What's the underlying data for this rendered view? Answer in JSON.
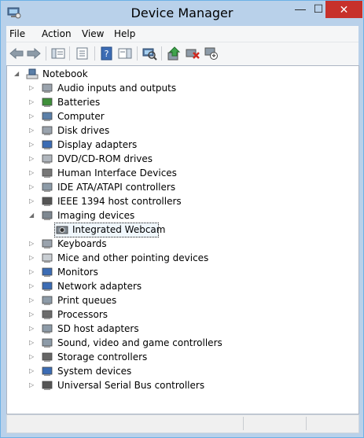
{
  "window": {
    "title": "Device Manager",
    "minimize": "—",
    "maximize": "☐",
    "close": "✕"
  },
  "menu": [
    "File",
    "Action",
    "View",
    "Help"
  ],
  "toolbar": {
    "buttons": [
      "back",
      "forward",
      "show-hide-console-tree",
      "properties",
      "help",
      "action-pane",
      "scan-for-hardware-changes",
      "update-driver",
      "uninstall",
      "disable"
    ]
  },
  "tree": {
    "root": "Notebook",
    "categories": [
      {
        "label": "Audio inputs and outputs",
        "icon": "speaker-icon",
        "expanded": false
      },
      {
        "label": "Batteries",
        "icon": "battery-icon",
        "expanded": false
      },
      {
        "label": "Computer",
        "icon": "computer-icon",
        "expanded": false
      },
      {
        "label": "Disk drives",
        "icon": "disk-drive-icon",
        "expanded": false
      },
      {
        "label": "Display adapters",
        "icon": "display-adapter-icon",
        "expanded": false
      },
      {
        "label": "DVD/CD-ROM drives",
        "icon": "dvd-drive-icon",
        "expanded": false
      },
      {
        "label": "Human Interface Devices",
        "icon": "hid-icon",
        "expanded": false
      },
      {
        "label": "IDE ATA/ATAPI controllers",
        "icon": "ide-controller-icon",
        "expanded": false
      },
      {
        "label": "IEEE 1394 host controllers",
        "icon": "firewire-icon",
        "expanded": false
      },
      {
        "label": "Imaging devices",
        "icon": "camera-icon",
        "expanded": true
      },
      {
        "label": "Keyboards",
        "icon": "keyboard-icon",
        "expanded": false
      },
      {
        "label": "Mice and other pointing devices",
        "icon": "mouse-icon",
        "expanded": false
      },
      {
        "label": "Monitors",
        "icon": "monitor-icon",
        "expanded": false
      },
      {
        "label": "Network adapters",
        "icon": "network-adapter-icon",
        "expanded": false
      },
      {
        "label": "Print queues",
        "icon": "printer-icon",
        "expanded": false
      },
      {
        "label": "Processors",
        "icon": "processor-icon",
        "expanded": false
      },
      {
        "label": "SD host adapters",
        "icon": "sd-card-icon",
        "expanded": false
      },
      {
        "label": "Sound, video and game controllers",
        "icon": "sound-icon",
        "expanded": false
      },
      {
        "label": "Storage controllers",
        "icon": "storage-controller-icon",
        "expanded": false
      },
      {
        "label": "System devices",
        "icon": "system-devices-icon",
        "expanded": false
      },
      {
        "label": "Universal Serial Bus controllers",
        "icon": "usb-icon",
        "expanded": false
      }
    ],
    "imaging_children": [
      "Integrated Webcam"
    ],
    "selected": "Integrated Webcam"
  },
  "colors": {
    "frame": "#b9d1ea",
    "close_button": "#c7312b",
    "selection_bg": "#f0f7fd"
  }
}
